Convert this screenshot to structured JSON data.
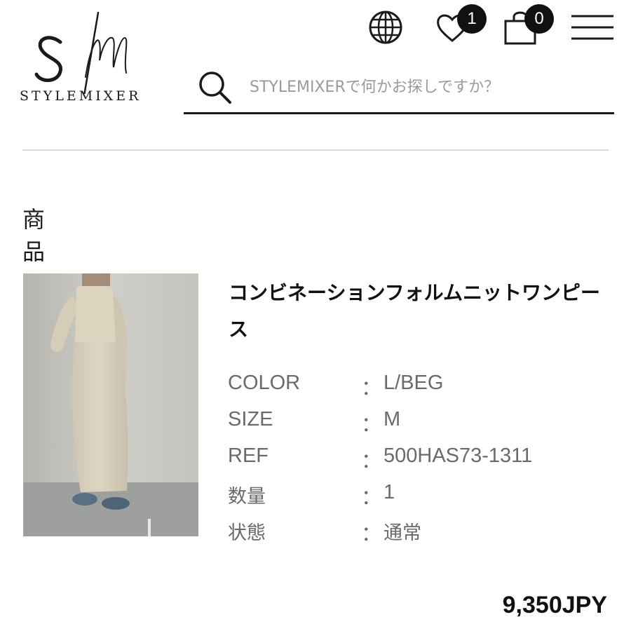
{
  "header": {
    "logo_text": "STYLEMIXER",
    "logo_monogram": "SM",
    "globe_icon": "globe-icon",
    "wishlist": {
      "icon": "heart-icon",
      "count": "1"
    },
    "cart": {
      "icon": "shopping-bag-icon",
      "count": "0"
    },
    "menu_icon": "hamburger-menu-icon"
  },
  "search": {
    "icon": "search-icon",
    "placeholder": "STYLEMIXERで何かお探しですか？"
  },
  "section": {
    "title": "商品"
  },
  "product": {
    "name": "コンビネーションフォルムニットワンピース",
    "specs": [
      {
        "label": "COLOR",
        "colon": "：",
        "value": "L/BEG"
      },
      {
        "label": "SIZE",
        "colon": "：",
        "value": "M"
      },
      {
        "label": "REF",
        "colon": "：",
        "value": "500HAS73-1311"
      },
      {
        "label": "数量",
        "colon": "：",
        "value": "1"
      },
      {
        "label": "状態",
        "colon": "：",
        "value": "通常"
      }
    ],
    "price": "9,350JPY"
  }
}
